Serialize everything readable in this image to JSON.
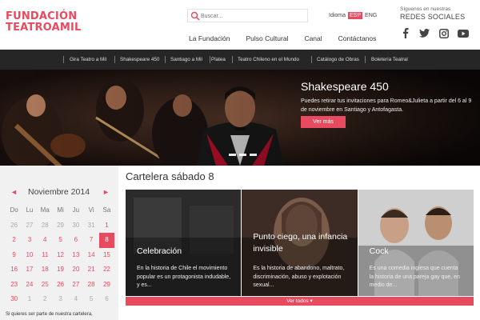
{
  "header": {
    "logo_line1": "FUNDACIÓN",
    "logo_line2": "TEATROAMIL",
    "search_placeholder": "Buscar...",
    "lang_label": "Idioma",
    "lang_active": "ESP",
    "lang_other": "ENG",
    "social_label": "Síguenos en nuestras",
    "social_title": "REDES SOCIALES",
    "social_icons": [
      "facebook-icon",
      "twitter-icon",
      "instagram-icon",
      "youtube-icon"
    ],
    "nav": [
      "La Fundación",
      "Pulso Cultural",
      "Canal",
      "Contáctanos"
    ]
  },
  "subnav": [
    "Gira Teatro a Mil",
    "Shakespeare 450",
    "Santiago a Mil",
    "Platea",
    "Teatro Chileno en el Mundo",
    "Catálogo de Obras",
    "Boletería Teatral"
  ],
  "hero": {
    "title": "Shakespeare 450",
    "text": "Puedes retirar tus invitaciones para Romeo&Julieta a partir del 6 al 9 de noviembre en Santiago y Antofagasta.",
    "button": "Ver más"
  },
  "calendar": {
    "prev": "◄",
    "next": "►",
    "month": "Noviembre 2014",
    "days": [
      "Do",
      "Lu",
      "Ma",
      "Mi",
      "Ju",
      "Vi",
      "Sa"
    ],
    "weeks": [
      [
        "26",
        "27",
        "28",
        "29",
        "30",
        "31",
        "1"
      ],
      [
        "2",
        "3",
        "4",
        "5",
        "6",
        "7",
        "8"
      ],
      [
        "9",
        "10",
        "11",
        "12",
        "13",
        "14",
        "15"
      ],
      [
        "16",
        "17",
        "18",
        "19",
        "20",
        "21",
        "22"
      ],
      [
        "23",
        "24",
        "25",
        "26",
        "27",
        "28",
        "29"
      ],
      [
        "30",
        "1",
        "2",
        "3",
        "4",
        "5",
        "6"
      ]
    ],
    "selected": "8",
    "footer": "Si quieres ser parte de nuestra cartelera,"
  },
  "cartelera": {
    "title": "Cartelera sábado 8",
    "cards": [
      {
        "title": "Celebración",
        "desc": "En la historia de Chile el movimiento popular es un protagonista indudable, y es..."
      },
      {
        "title": "Punto ciego, una infancia invisible",
        "desc": "Es la historia de abandono, maltrato, discriminación, abuso y explotación sexual..."
      },
      {
        "title": "Cock",
        "desc": "Es una comedia inglesa que cuenta la historia de una pareja gay que, en medio de..."
      }
    ],
    "ver_todos": "Ver todos ▾"
  },
  "colors": {
    "accent": "#e84a5f",
    "subnav_bg": "#262626",
    "calendar_bg": "#f1f1f1"
  }
}
